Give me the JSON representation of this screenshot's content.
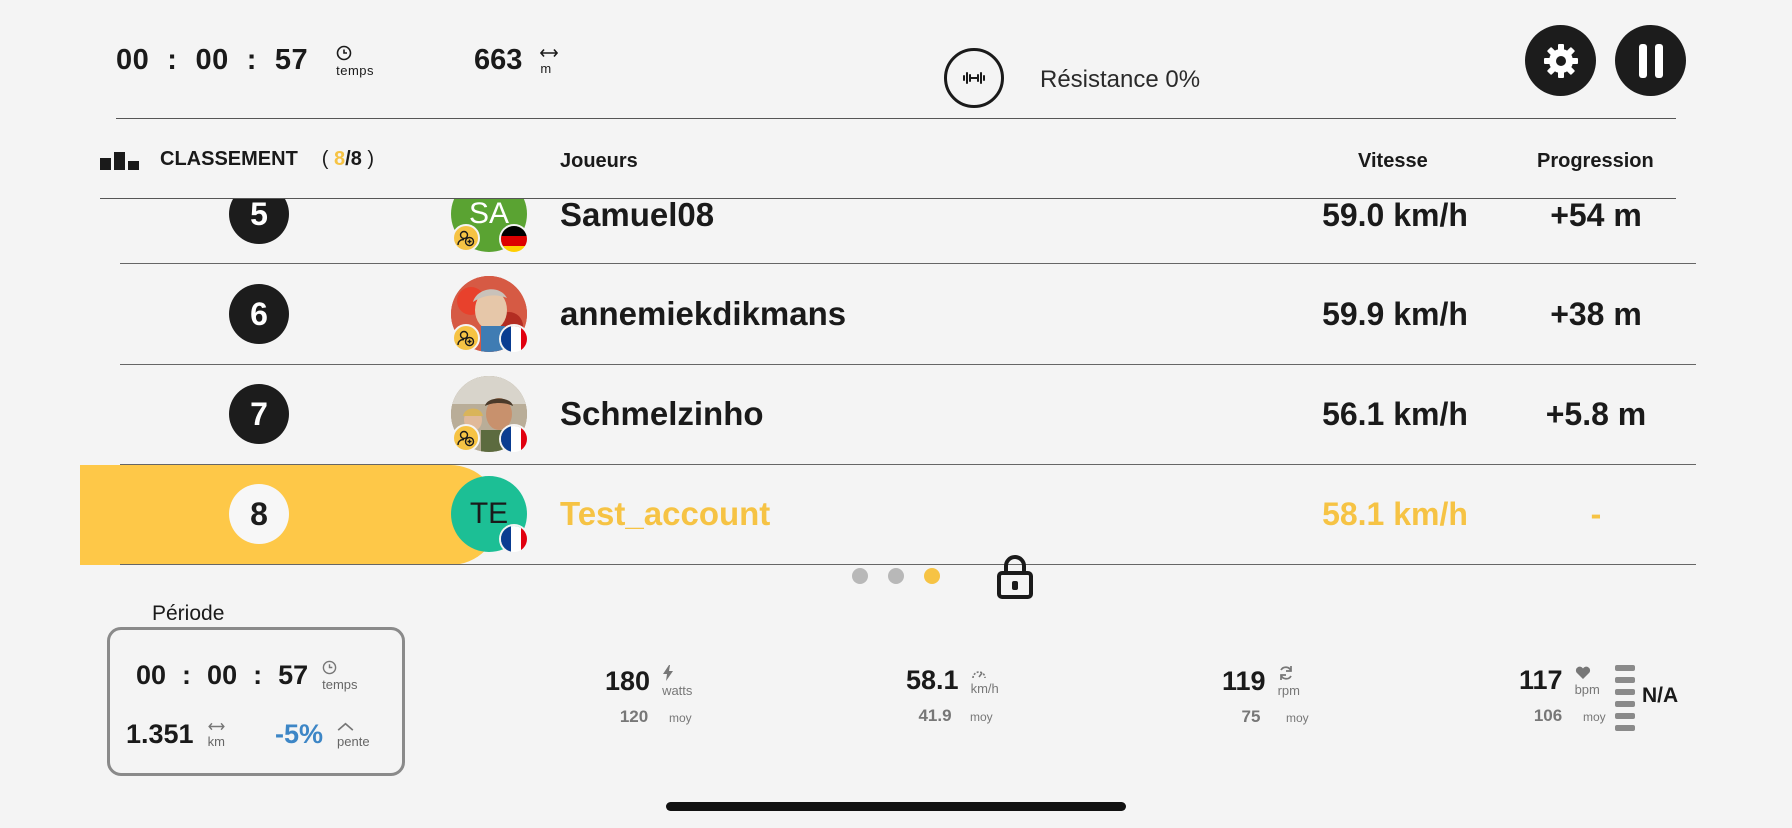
{
  "top_bar": {
    "timer": {
      "hours": "00",
      "minutes": "00",
      "seconds": "57",
      "sep": ":",
      "unit": "temps"
    },
    "distance": {
      "value": "663",
      "unit": "m"
    },
    "resistance_label": "Résistance 0%"
  },
  "ranking": {
    "title": "CLASSEMENT",
    "open_paren": "(",
    "current": "8",
    "slash_total": "/8",
    "close_paren": ")",
    "columns": {
      "players": "Joueurs",
      "speed": "Vitesse",
      "progress": "Progression"
    },
    "rows": [
      {
        "rank": "5",
        "name": "Samuel08",
        "avatar_initials": "SA",
        "speed": "59.0 km/h",
        "progress": "+54 m"
      },
      {
        "rank": "6",
        "name": "annemiekdikmans",
        "avatar_initials": "",
        "speed": "59.9 km/h",
        "progress": "+38 m"
      },
      {
        "rank": "7",
        "name": "Schmelzinho",
        "avatar_initials": "",
        "speed": "56.1 km/h",
        "progress": "+5.8 m"
      },
      {
        "rank": "8",
        "name": "Test_account",
        "avatar_initials": "TE",
        "speed": "58.1 km/h",
        "progress": "-"
      }
    ],
    "page": {
      "current": 3,
      "total": 3
    }
  },
  "period": {
    "title": "Période",
    "timer": {
      "hours": "00",
      "minutes": "00",
      "seconds": "57",
      "sep": ":",
      "unit": "temps"
    },
    "distance": {
      "value": "1.351",
      "unit": "km"
    },
    "slope": {
      "value": "-5%",
      "unit": "pente"
    }
  },
  "metrics": {
    "power": {
      "value": "180",
      "unit": "watts",
      "avg": "120",
      "avg_label": "moy"
    },
    "speed": {
      "value": "58.1",
      "unit": "km/h",
      "avg": "41.9",
      "avg_label": "moy"
    },
    "cadence": {
      "value": "119",
      "unit": "rpm",
      "avg": "75",
      "avg_label": "moy"
    },
    "heart": {
      "value": "117",
      "unit": "bpm",
      "avg": "106",
      "avg_label": "moy"
    },
    "zone": "N/A"
  },
  "colors": {
    "accent": "#f6c344",
    "highlight": "#fec848",
    "slope": "#3d86c6",
    "dark": "#1c1c1c"
  }
}
